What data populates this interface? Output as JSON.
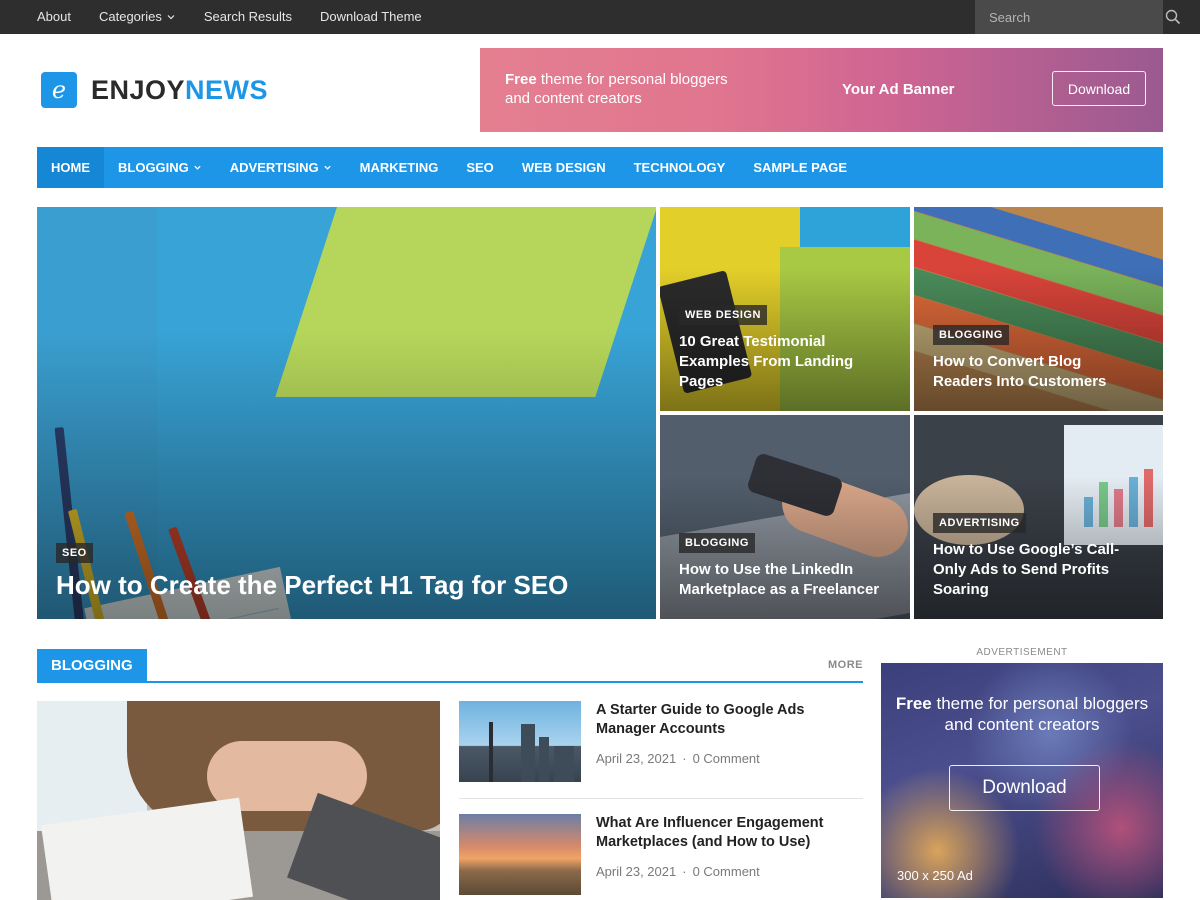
{
  "topbar": {
    "links": [
      "About",
      "Categories",
      "Search Results",
      "Download Theme"
    ],
    "search_placeholder": "Search"
  },
  "header": {
    "logo_letter": "e",
    "logo_part1": "ENJOY",
    "logo_part2": "NEWS",
    "banner": {
      "free": "Free",
      "text": " theme for personal bloggers and content creators",
      "ad_label": "Your Ad Banner",
      "button": "Download"
    }
  },
  "nav": {
    "items": [
      "Home",
      "Blogging",
      "Advertising",
      "Marketing",
      "SEO",
      "Web Design",
      "Technology",
      "Sample Page"
    ]
  },
  "featured": {
    "main": {
      "category": "SEO",
      "title": "How to Create the Perfect H1 Tag for SEO"
    },
    "s1": {
      "category": "Web Design",
      "title": "10 Great Testimonial Examples From Landing Pages"
    },
    "s2": {
      "category": "Blogging",
      "title": "How to Convert Blog Readers Into Customers"
    },
    "s3": {
      "category": "Blogging",
      "title": "How to Use the LinkedIn Marketplace as a Freelancer"
    },
    "s4": {
      "category": "Advertising",
      "title": "How to Use Google’s Call-Only Ads to Send Profits Soaring"
    }
  },
  "section": {
    "title": "Blogging",
    "more": "MORE",
    "posts": [
      {
        "title": "A Starter Guide to Google Ads Manager Accounts",
        "date": "April 23, 2021",
        "comments": "0 Comment"
      },
      {
        "title": "What Are Influencer Engagement Marketplaces (and How to Use)",
        "date": "April 23, 2021",
        "comments": "0 Comment"
      }
    ]
  },
  "sidebar": {
    "ad_label": "ADVERTISEMENT",
    "free": "Free",
    "text": " theme for personal bloggers and content creators",
    "button": "Download",
    "size": "300 x 250 Ad"
  },
  "colors": {
    "accent": "#1e96e8",
    "topbar": "#2e2e2e"
  }
}
